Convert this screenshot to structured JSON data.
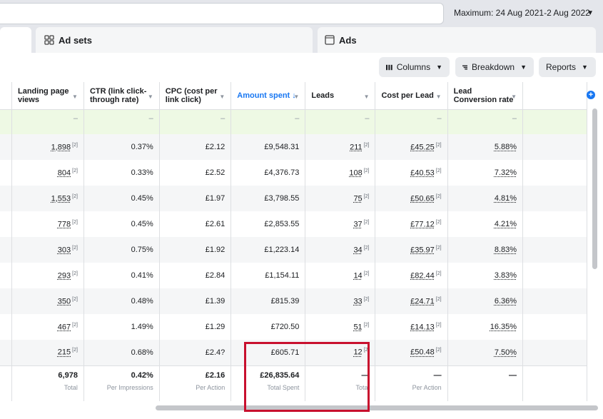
{
  "header": {
    "date_range": "Maximum: 24 Aug 2021-2 Aug 2022"
  },
  "tabs": [
    {
      "label": "",
      "icon": "campaigns-tab"
    },
    {
      "label": "Ad sets",
      "icon": "ad-sets-icon"
    },
    {
      "label": "Ads",
      "icon": "ads-icon"
    }
  ],
  "toolbar": {
    "columns_label": "Columns",
    "breakdown_label": "Breakdown",
    "reports_label": "Reports"
  },
  "table": {
    "headers": [
      {
        "label": "Landing page views",
        "sorted": false
      },
      {
        "label": "CTR (link click-through rate)",
        "sorted": false
      },
      {
        "label": "CPC (cost per link click)",
        "sorted": false
      },
      {
        "label": "Amount spent ↓",
        "sorted": true
      },
      {
        "label": "Leads",
        "sorted": false
      },
      {
        "label": "Cost per Lead",
        "sorted": false
      },
      {
        "label": "Lead Conversion rate",
        "sorted": false
      }
    ],
    "summary_row": [
      "–",
      "–",
      "–",
      "–",
      "–",
      "–",
      "–"
    ],
    "rows": [
      [
        "1,898",
        "0.37%",
        "£2.12",
        "£9,548.31",
        "211",
        "£45.25",
        "5.88%"
      ],
      [
        "804",
        "0.33%",
        "£2.52",
        "£4,376.73",
        "108",
        "£40.53",
        "7.32%"
      ],
      [
        "1,553",
        "0.45%",
        "£1.97",
        "£3,798.55",
        "75",
        "£50.65",
        "4.81%"
      ],
      [
        "778",
        "0.45%",
        "£2.61",
        "£2,853.55",
        "37",
        "£77.12",
        "4.21%"
      ],
      [
        "303",
        "0.75%",
        "£1.92",
        "£1,223.14",
        "34",
        "£35.97",
        "8.83%"
      ],
      [
        "293",
        "0.41%",
        "£2.84",
        "£1,154.11",
        "14",
        "£82.44",
        "3.83%"
      ],
      [
        "350",
        "0.48%",
        "£1.39",
        "£815.39",
        "33",
        "£24.71",
        "6.36%"
      ],
      [
        "467",
        "1.49%",
        "£1.29",
        "£720.50",
        "51",
        "£14.13",
        "16.35%"
      ],
      [
        "215",
        "0.68%",
        "£2.4?",
        "£605.71",
        "12",
        "£50.48",
        "7.50%"
      ]
    ],
    "superscript": "[2]",
    "totals": [
      {
        "value": "6,978",
        "label": "Total"
      },
      {
        "value": "0.42%",
        "label": "Per Impressions"
      },
      {
        "value": "£2.16",
        "label": "Per Action"
      },
      {
        "value": "£26,835.64",
        "label": "Total Spent"
      },
      {
        "value": "—",
        "label": "Total"
      },
      {
        "value": "—",
        "label": "Per Action"
      },
      {
        "value": "—",
        "label": ""
      }
    ]
  }
}
